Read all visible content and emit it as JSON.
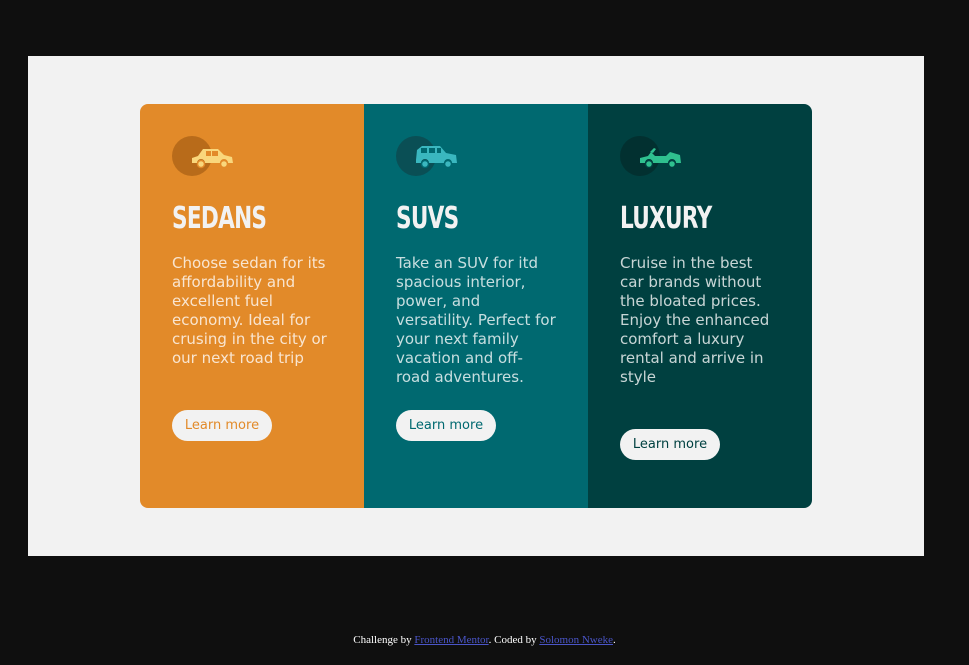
{
  "cards": [
    {
      "title": "Sedans",
      "description": "Choose sedan for its affordability and excellent fuel economy. Ideal for crusing in the city or our next road trip",
      "button_label": "Learn more",
      "icon": "sedan-car-icon",
      "color": "#e28a29"
    },
    {
      "title": "SUVs",
      "description": "Take an SUV for itd spacious interior, power, and versatility. Perfect for your next family vacation and off-road adventures.",
      "button_label": "Learn more",
      "icon": "suv-car-icon",
      "color": "#006970"
    },
    {
      "title": "Luxury",
      "description": "Cruise in the best car brands without the bloated prices. Enjoy the enhanced comfort a luxury rental and arrive in style",
      "button_label": "Learn more",
      "icon": "convertible-car-icon",
      "color": "#004040"
    }
  ],
  "footer": {
    "prefix": "Challenge by ",
    "link1": "Frontend Mentor",
    "middle": ". Coded by ",
    "link2": "Solomon Nweke",
    "suffix": "."
  }
}
